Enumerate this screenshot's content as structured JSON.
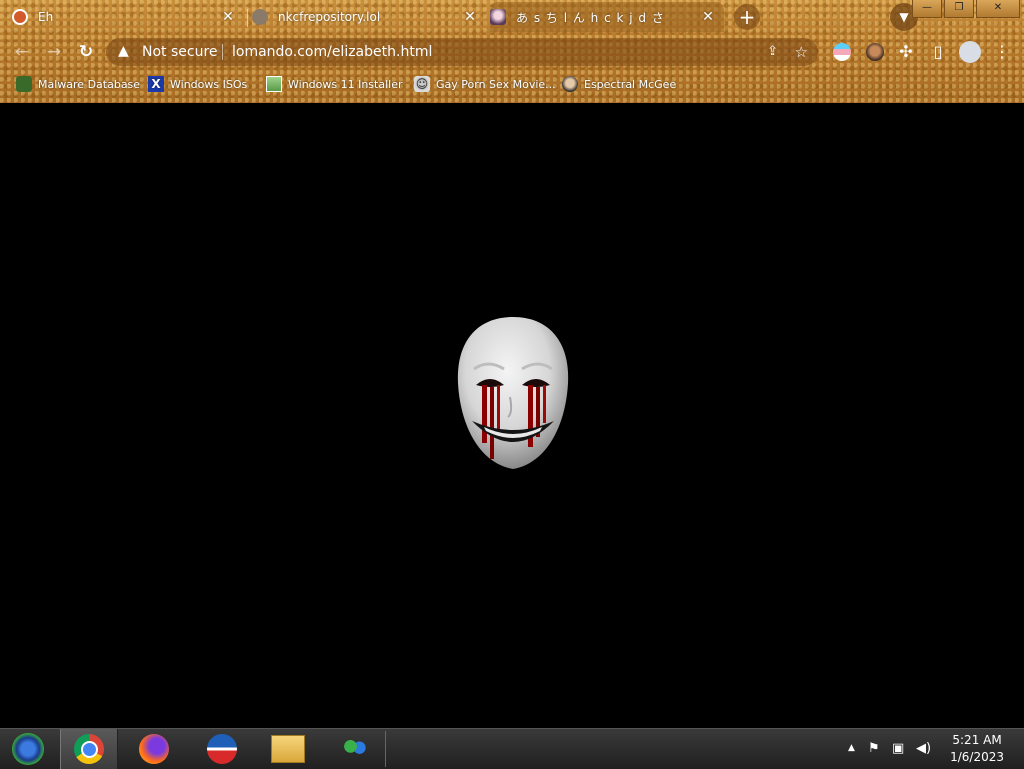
{
  "browser": {
    "tabs": [
      {
        "title": "Eh",
        "close": "✕",
        "active": false
      },
      {
        "title": "nkcfrepository.lol",
        "close": "✕",
        "active": false
      },
      {
        "title": "あ s ち l ん h c k j d さ",
        "close": "✕",
        "active": true
      }
    ],
    "new_tab_label": "+",
    "tab_search_icon": "chevron-down-icon",
    "window_controls": {
      "minimize": "—",
      "restore": "❐",
      "close": "✕"
    },
    "nav": {
      "back": "←",
      "forward": "→",
      "reload": "↻"
    },
    "omnibox": {
      "security_label": "Not secure",
      "url": "lomando.com/elizabeth.html"
    }
  },
  "bookmarks": [
    {
      "label": "Malware Database",
      "icon": "leaf-icon"
    },
    {
      "label": "Windows ISOs",
      "icon": "x-icon"
    },
    {
      "label": "Windows 11 Installer",
      "icon": "image-icon"
    },
    {
      "label": "Gay Porn Sex Movie...",
      "icon": "robot-icon"
    },
    {
      "label": "Espectral McGee",
      "icon": "face-icon"
    }
  ],
  "page": {
    "image": "smiling-mask-bleeding-eyes"
  },
  "taskbar": {
    "apps": [
      "start-orb",
      "chrome",
      "firefox",
      "outlook",
      "file-explorer",
      "messenger"
    ],
    "tray_expand": "▲",
    "clock": {
      "time": "5:21 AM",
      "date": "1/6/2023"
    }
  },
  "colors": {
    "chrome_gold": "#b87a2c",
    "mask_blood": "#8a0000"
  }
}
